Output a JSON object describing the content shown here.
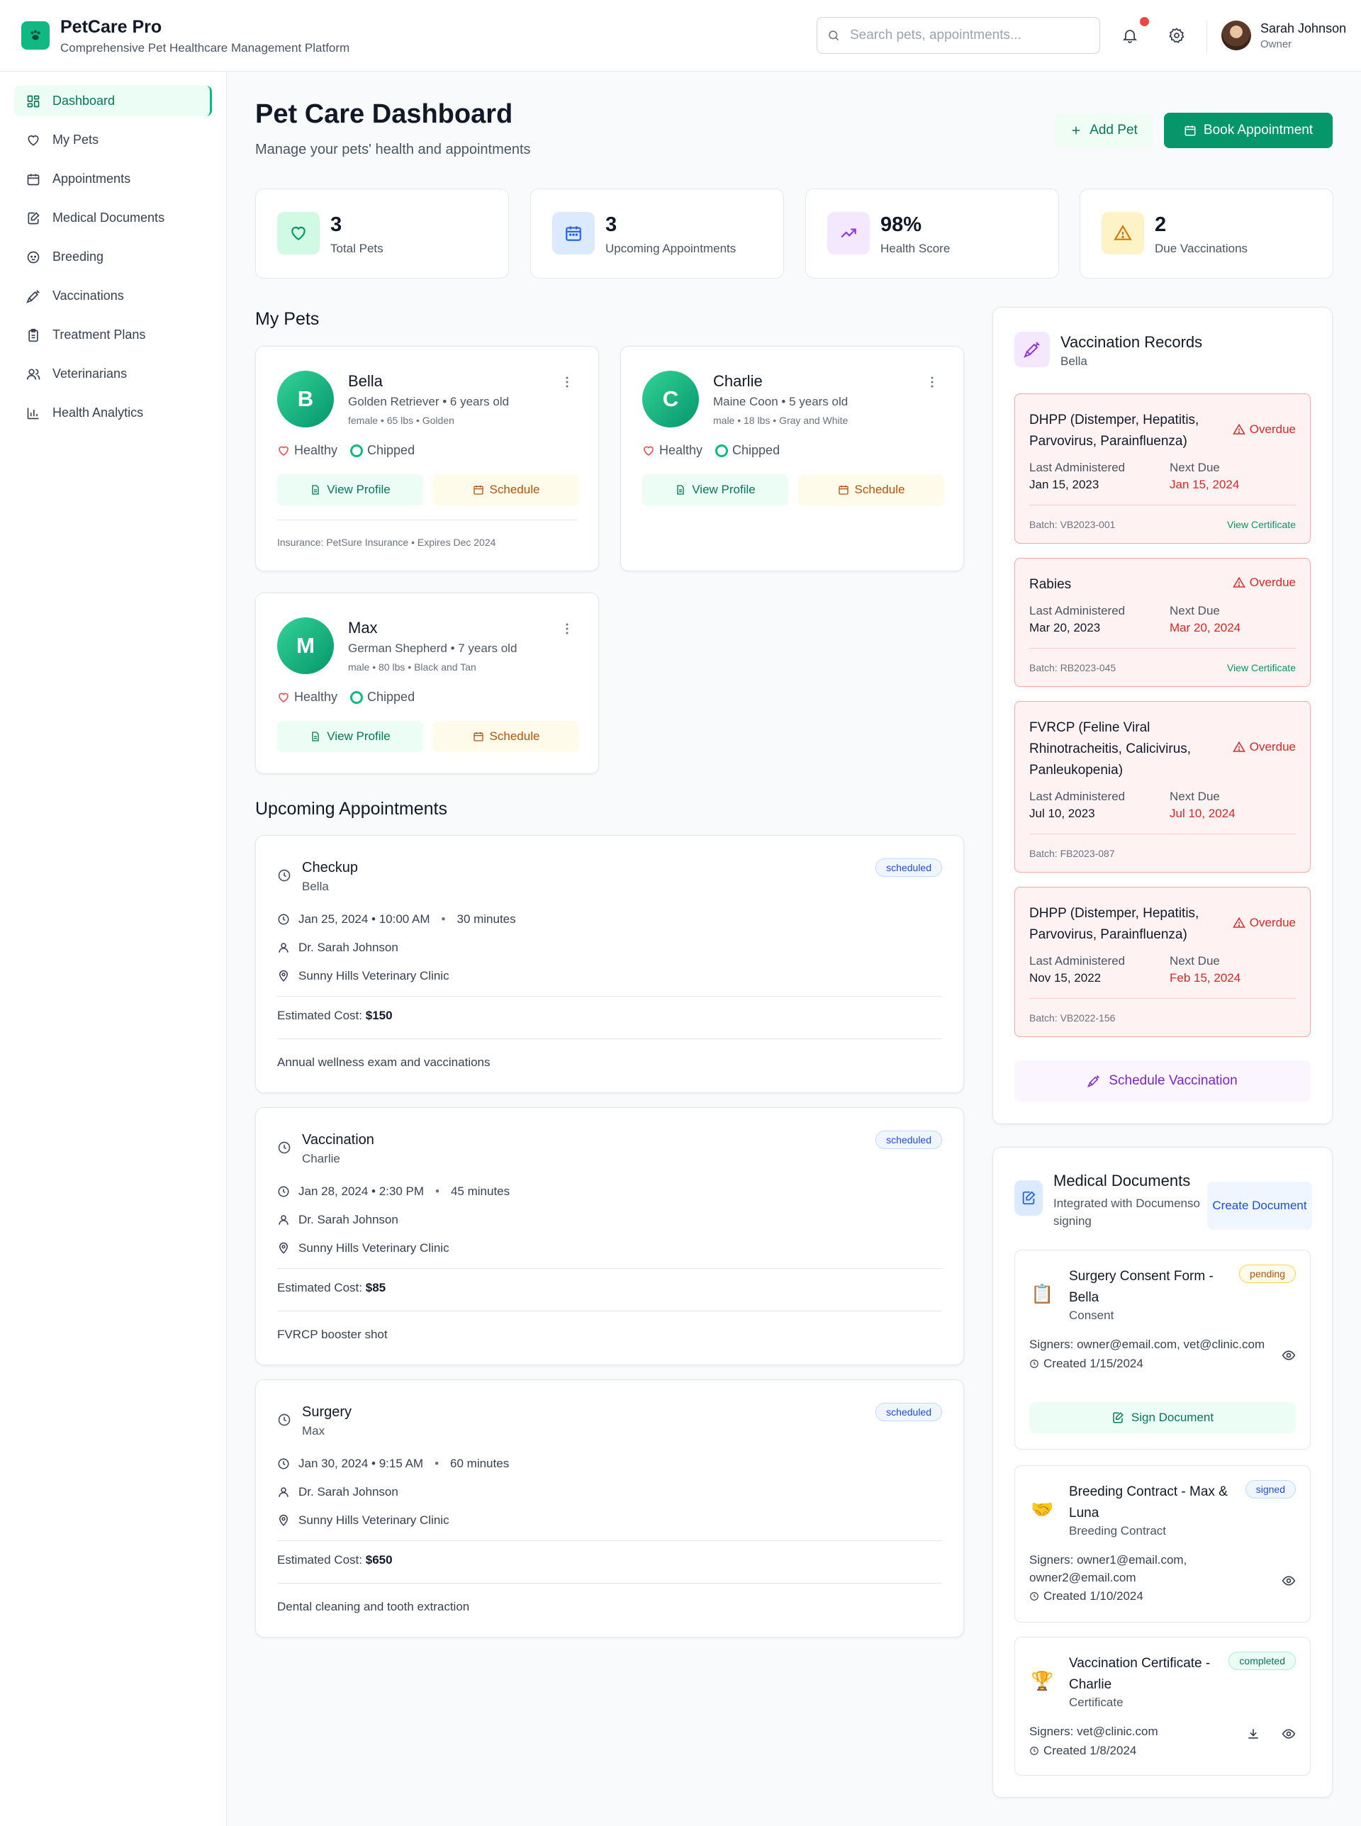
{
  "header": {
    "app_title": "PetCare Pro",
    "app_subtitle": "Comprehensive Pet Healthcare Management Platform",
    "search_placeholder": "Search pets, appointments...",
    "user_name": "Sarah Johnson",
    "user_role": "Owner"
  },
  "sidebar": {
    "items": [
      {
        "label": "Dashboard",
        "icon": "dashboard-icon",
        "active": true
      },
      {
        "label": "My Pets",
        "icon": "heart-icon"
      },
      {
        "label": "Appointments",
        "icon": "calendar-icon"
      },
      {
        "label": "Medical Documents",
        "icon": "document-edit-icon"
      },
      {
        "label": "Breeding",
        "icon": "baby-icon"
      },
      {
        "label": "Vaccinations",
        "icon": "syringe-icon"
      },
      {
        "label": "Treatment Plans",
        "icon": "clipboard-icon"
      },
      {
        "label": "Veterinarians",
        "icon": "users-icon"
      },
      {
        "label": "Health Analytics",
        "icon": "bar-chart-icon"
      }
    ]
  },
  "page": {
    "title": "Pet Care Dashboard",
    "subtitle": "Manage your pets' health and appointments",
    "add_pet_label": "Add Pet",
    "book_label": "Book Appointment"
  },
  "stats": [
    {
      "value": "3",
      "label": "Total Pets",
      "icon": "heart-icon",
      "color": "#10b981"
    },
    {
      "value": "3",
      "label": "Upcoming Appointments",
      "icon": "calendar-icon",
      "color": "#3b82f6"
    },
    {
      "value": "98%",
      "label": "Health Score",
      "icon": "trending-up-icon",
      "color": "#9333ea"
    },
    {
      "value": "2",
      "label": "Due Vaccinations",
      "icon": "warning-icon",
      "color": "#d97706"
    }
  ],
  "pets_section_title": "My Pets",
  "pets": [
    {
      "initial": "B",
      "name": "Bella",
      "breed": "Golden Retriever • 6 years old",
      "meta": "female • 65 lbs • Golden",
      "health": "Healthy",
      "chip": "Chipped",
      "profile_label": "View Profile",
      "schedule_label": "Schedule",
      "insurance": "Insurance: PetSure Insurance • Expires Dec 2024"
    },
    {
      "initial": "C",
      "name": "Charlie",
      "breed": "Maine Coon • 5 years old",
      "meta": "male • 18 lbs • Gray and White",
      "health": "Healthy",
      "chip": "Chipped",
      "profile_label": "View Profile",
      "schedule_label": "Schedule"
    },
    {
      "initial": "M",
      "name": "Max",
      "breed": "German Shepherd • 7 years old",
      "meta": "male • 80 lbs • Black and Tan",
      "health": "Healthy",
      "chip": "Chipped",
      "profile_label": "View Profile",
      "schedule_label": "Schedule"
    }
  ],
  "appointments_section_title": "Upcoming Appointments",
  "appointments": [
    {
      "type": "Checkup",
      "pet": "Bella",
      "status": "scheduled",
      "datetime": "Jan 25, 2024 • 10:00 AM",
      "duration": "30 minutes",
      "vet": "Dr. Sarah Johnson",
      "clinic": "Sunny Hills Veterinary Clinic",
      "cost_label": "Estimated Cost:",
      "cost": "$150",
      "note": "Annual wellness exam and vaccinations"
    },
    {
      "type": "Vaccination",
      "pet": "Charlie",
      "status": "scheduled",
      "datetime": "Jan 28, 2024 • 2:30 PM",
      "duration": "45 minutes",
      "vet": "Dr. Sarah Johnson",
      "clinic": "Sunny Hills Veterinary Clinic",
      "cost_label": "Estimated Cost:",
      "cost": "$85",
      "note": "FVRCP booster shot"
    },
    {
      "type": "Surgery",
      "pet": "Max",
      "status": "scheduled",
      "datetime": "Jan 30, 2024 • 9:15 AM",
      "duration": "60 minutes",
      "vet": "Dr. Sarah Johnson",
      "clinic": "Sunny Hills Veterinary Clinic",
      "cost_label": "Estimated Cost:",
      "cost": "$650",
      "note": "Dental cleaning and tooth extraction"
    }
  ],
  "vaccination_panel": {
    "title": "Vaccination Records",
    "subtitle": "Bella",
    "last_label": "Last Administered",
    "next_label": "Next Due",
    "cert_label": "View Certificate",
    "schedule_label": "Schedule Vaccination",
    "records": [
      {
        "name": "DHPP (Distemper, Hepatitis, Parvovirus, Parainfluenza)",
        "status": "Overdue",
        "last": "Jan 15, 2023",
        "next": "Jan 15, 2024",
        "batch": "Batch: VB2023-001",
        "has_cert": true
      },
      {
        "name": "Rabies",
        "status": "Overdue",
        "last": "Mar 20, 2023",
        "next": "Mar 20, 2024",
        "batch": "Batch: RB2023-045",
        "has_cert": true
      },
      {
        "name": "FVRCP (Feline Viral Rhinotracheitis, Calicivirus, Panleukopenia)",
        "status": "Overdue",
        "last": "Jul 10, 2023",
        "next": "Jul 10, 2024",
        "batch": "Batch: FB2023-087",
        "has_cert": false
      },
      {
        "name": "DHPP (Distemper, Hepatitis, Parvovirus, Parainfluenza)",
        "status": "Overdue",
        "last": "Nov 15, 2022",
        "next": "Feb 15, 2024",
        "batch": "Batch: VB2022-156",
        "has_cert": false
      }
    ]
  },
  "documents_panel": {
    "title": "Medical Documents",
    "subtitle": "Integrated with Documenso signing",
    "create_label": "Create Document",
    "sign_label": "Sign Document",
    "docs": [
      {
        "emoji": "📋",
        "title": "Surgery Consent Form - Bella",
        "type": "Consent",
        "status": "pending",
        "signers": "Signers: owner@email.com, vet@clinic.com",
        "created": "Created 1/15/2024"
      },
      {
        "emoji": "🤝",
        "title": "Breeding Contract - Max & Luna",
        "type": "Breeding Contract",
        "status": "signed",
        "signers": "Signers: owner1@email.com, owner2@email.com",
        "created": "Created 1/10/2024"
      },
      {
        "emoji": "🏆",
        "title": "Vaccination Certificate - Charlie",
        "type": "Certificate",
        "status": "completed",
        "signers": "Signers: vet@clinic.com",
        "created": "Created 1/8/2024"
      }
    ]
  },
  "colors": {
    "primary": "#059669",
    "danger": "#dc2626",
    "accent_purple": "#9333ea"
  }
}
